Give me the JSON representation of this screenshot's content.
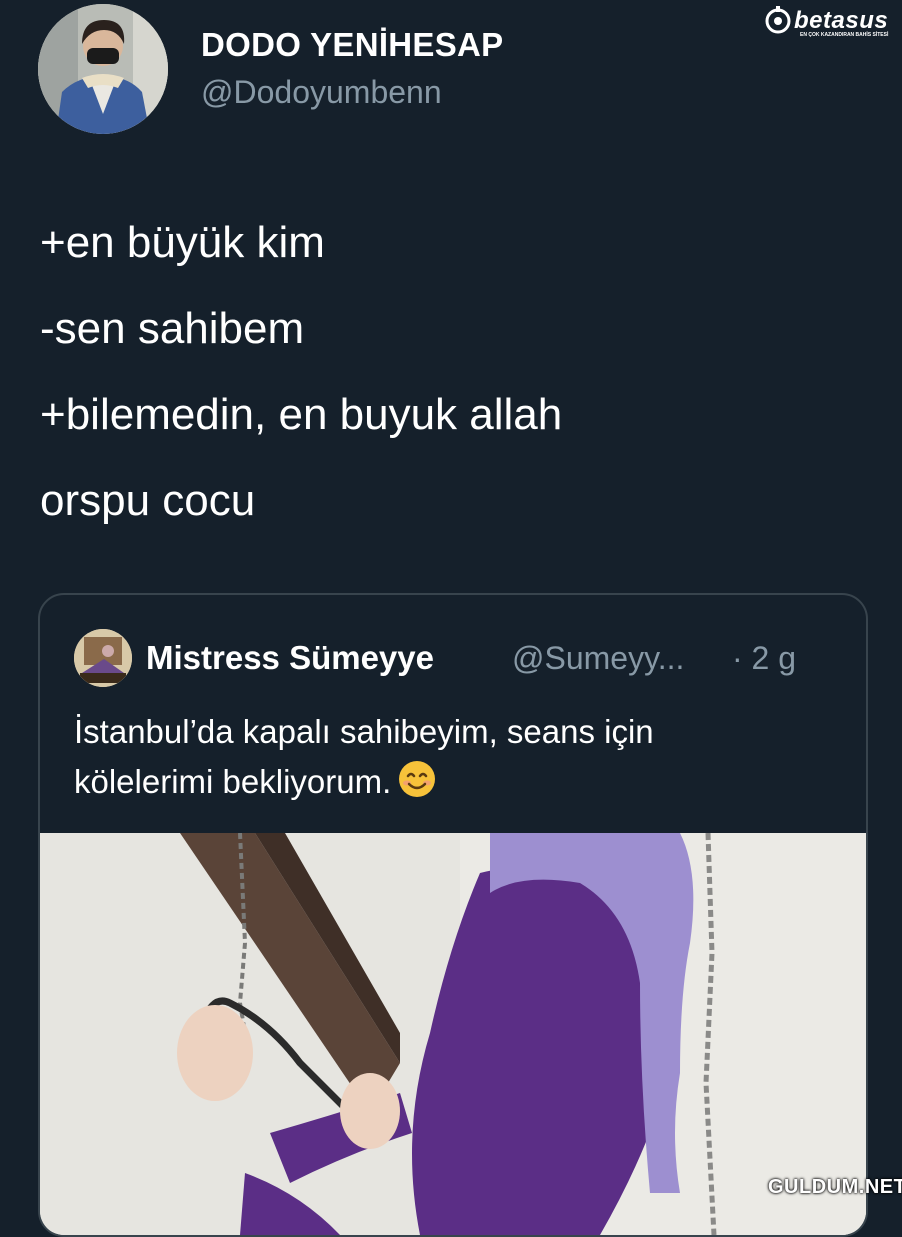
{
  "tweet": {
    "display_name": "DODO YENİHESAP",
    "handle": "@Dodoyumbenn",
    "lines": [
      "+en büyük kim",
      "-sen sahibem",
      "+bilemedin, en buyuk allah",
      "orspu cocu"
    ]
  },
  "quoted_tweet": {
    "display_name": "Mistress Sümeyye",
    "handle": "@Sumeyy...",
    "time": "· 2 g",
    "lines": [
      "İstanbul’da kapalı sahibeyim, seans için",
      "kölelerimi bekliyorum."
    ],
    "emoji": "smiling-face-emoji"
  },
  "watermarks": {
    "top_brand": "betasus",
    "top_tagline": "EN ÇOK KAZANDIRAN BAHİS SİTESİ",
    "bottom": "GULDUM.NET"
  },
  "colors": {
    "background": "#15202b",
    "secondary_text": "#8899a6",
    "border": "#38444d"
  }
}
